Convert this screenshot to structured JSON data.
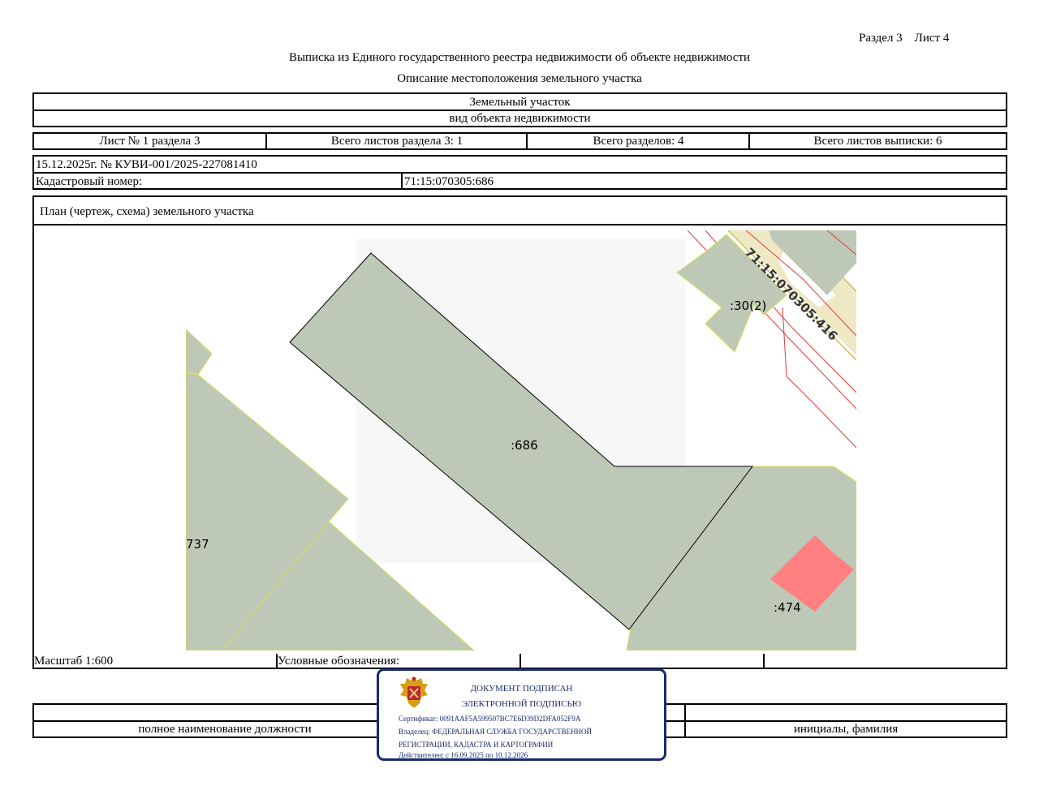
{
  "header": {
    "section_sheet": "Раздел 3    Лист 4",
    "title": "Выписка из Единого государственного реестра недвижимости об объекте недвижимости",
    "subtitle": "Описание местоположения земельного участка"
  },
  "object": {
    "type_value": "Земельный участок",
    "type_caption": "вид объекта недвижимости"
  },
  "sheet_info": {
    "sheet": "Лист № 1 раздела 3",
    "total_section_sheets": "Всего листов раздела 3: 1",
    "total_sections": "Всего разделов: 4",
    "total_extract_sheets": "Всего листов выписки: 6"
  },
  "record": {
    "date_number": "15.12.2025г. № КУВИ-001/2025-227081410",
    "cadastral_label": "Кадастровый номер:",
    "cadastral_value": "71:15:070305:686"
  },
  "plan": {
    "title": "План (чертеж, схема) земельного участка",
    "labels": {
      "main": ":686",
      "neighbor_30": ":30(2)",
      "road": "71:15:070305:416",
      "neighbor_737": "737",
      "neighbor_474": ":474"
    },
    "colors": {
      "parcel_fill": "#bec8b6",
      "road_fill": "#eee9c4",
      "building_fill": "#ff8080",
      "boundary_red": "#e23a3a",
      "boundary_yellow": "#d7e05a"
    }
  },
  "footer": {
    "scale": "Масштаб 1:600",
    "legend_label": "Условные обозначения:",
    "position_caption": "полное наименование должности",
    "name_caption": "инициалы, фамилия"
  },
  "stamp": {
    "line1": "ДОКУМЕНТ ПОДПИСАН",
    "line2": "ЭЛЕКТРОННОЙ ПОДПИСЬЮ",
    "certificate": "Сертификат: 0091AAF5A599507BC7E6D39D2DFA052F9A",
    "owner_line1": "Владелец: ФЕДЕРАЛЬНАЯ СЛУЖБА ГОСУДАРСТВЕННОЙ",
    "owner_line2": "РЕГИСТРАЦИИ, КАДАСТРА И КАРТОГРАФИИ",
    "valid": "Действителен: с 16.09.2025 по 10.12.2026",
    "border_color": "#1a2a6c"
  }
}
